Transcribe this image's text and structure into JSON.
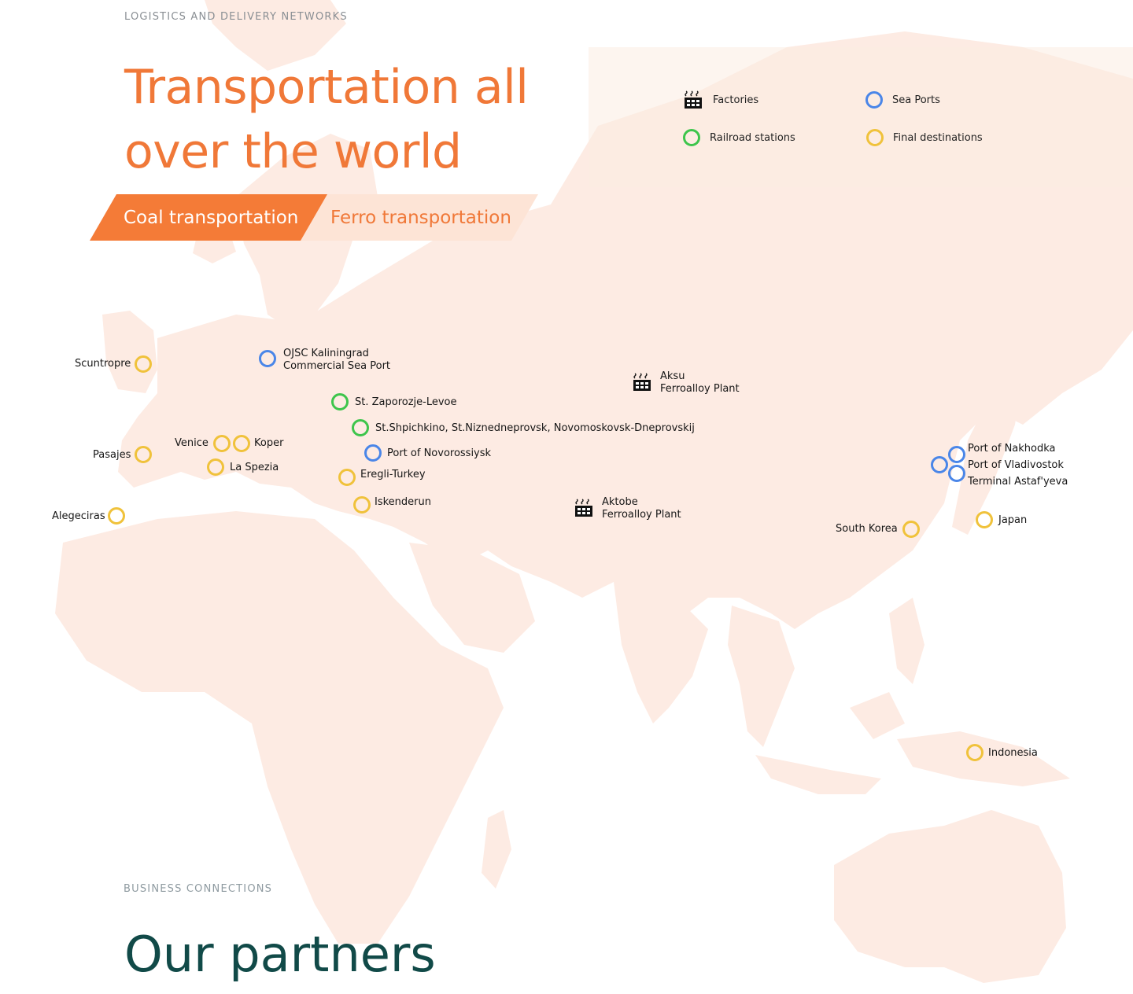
{
  "header": {
    "eyebrow": "LOGISTICS AND DELIVERY NETWORKS",
    "title_line1": "Transportation all",
    "title_line2": "over the world"
  },
  "tabs": {
    "coal": "Coal transportation",
    "ferro": "Ferro transportation"
  },
  "legend": {
    "factories": "Factories",
    "sea_ports": "Sea Ports",
    "railroad_stations": "Railroad stations",
    "final_destinations": "Final destinations"
  },
  "colors": {
    "accent": "#f47b37",
    "tab_inactive_bg": "#fde4d6",
    "sea_port": "#4a86e8",
    "railroad": "#3ec54c",
    "destination": "#f0c23b",
    "land": "#fdebe3",
    "heading_dark": "#114a48"
  },
  "locations": {
    "scuntropre": "Scuntropre",
    "kaliningrad_1": "OJSC Kaliningrad",
    "kaliningrad_2": "Commercial Sea Port",
    "aksu_1": "Aksu",
    "aksu_2": "Ferroalloy Plant",
    "zaporozje": "St. Zaporozje-Levoe",
    "shpichkino": "St.Shpichkino, St.Niznedneprovsk, Novomoskovsk-Dneprovskij",
    "venice": "Venice",
    "koper": "Koper",
    "pasajes": "Pasajes",
    "novorossiysk": "Port of Novorossiysk",
    "la_spezia": "La Spezia",
    "eregli": "Eregli-Turkey",
    "iskenderun": "Iskenderun",
    "aktobe_1": "Aktobe",
    "aktobe_2": "Ferroalloy Plant",
    "alegeciras": "Alegeciras",
    "nakhodka": "Port of Nakhodka",
    "vladivostok": "Port of Vladivostok",
    "astafyeva": "Terminal Astaf'yeva",
    "south_korea": "South Korea",
    "japan": "Japan",
    "indonesia": "Indonesia"
  },
  "partners": {
    "eyebrow": "BUSINESS CONNECTIONS",
    "title": "Our partners"
  }
}
